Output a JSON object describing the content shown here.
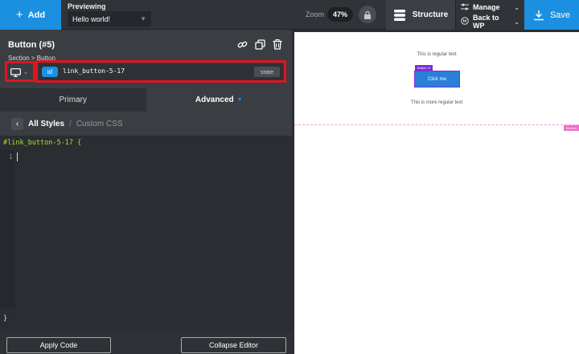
{
  "topbar": {
    "add_label": "Add",
    "previewing_label": "Previewing",
    "preview_page": "Hello world!",
    "zoom_label": "Zoom",
    "zoom_value": "47%",
    "structure_label": "Structure",
    "manage_label": "Manage",
    "back_to_wp_label": "Back to WP",
    "save_label": "Save"
  },
  "panel": {
    "element_title": "Button (#5)",
    "breadcrumb": "Section > Button",
    "selector_type": "id",
    "selector_value": "link_button-5-17",
    "state_label": "state"
  },
  "tabs": {
    "primary": "Primary",
    "advanced": "Advanced"
  },
  "subnav": {
    "all_styles": "All Styles",
    "separator": "/",
    "custom_css": "Custom CSS"
  },
  "editor": {
    "open_line": "#link_button-5-17 {",
    "line_number": "1",
    "close_line": "}",
    "apply_label": "Apply Code",
    "collapse_label": "Collapse Editor"
  },
  "canvas": {
    "text_top": "This is regular text",
    "button_tag": "Button",
    "button_label": "Click me",
    "text_bottom": "This is more regular text",
    "section_tag": "Section"
  },
  "colors": {
    "accent": "#1b8fe0",
    "highlight": "#e0141f",
    "button_outline": "#7a2fd6",
    "section_outline": "#ee6fc8"
  }
}
